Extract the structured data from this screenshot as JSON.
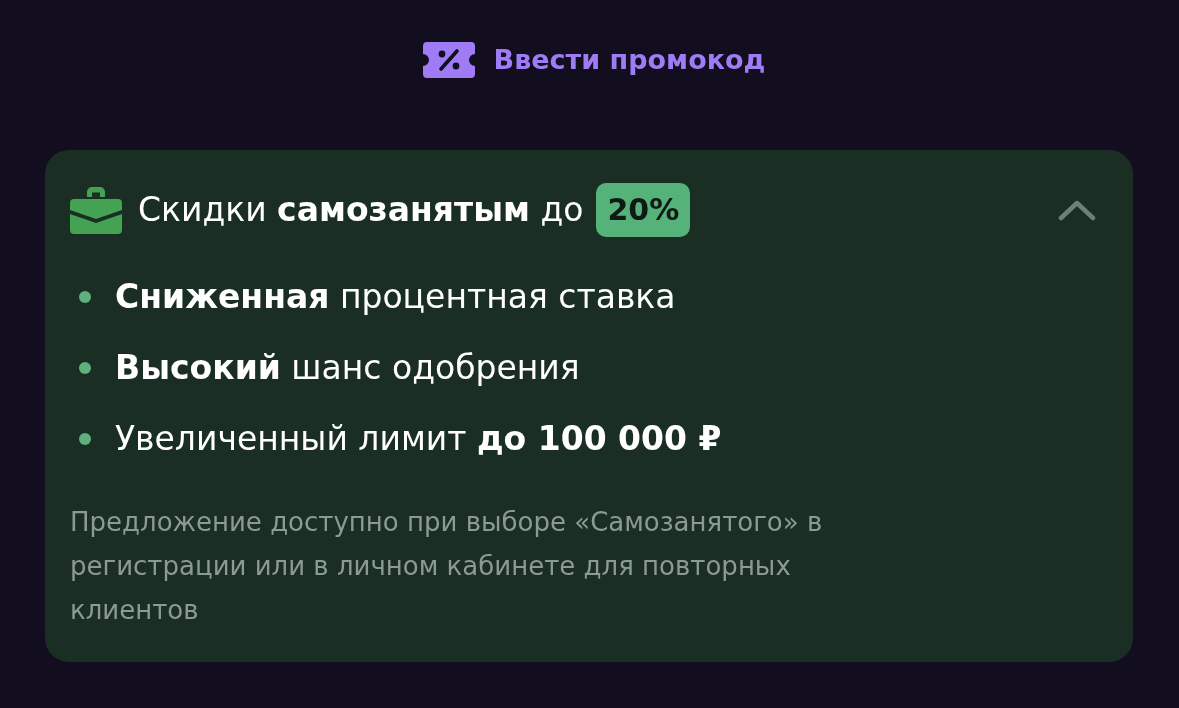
{
  "promo_link": {
    "label": "Ввести промокод"
  },
  "offer_card": {
    "title": "Скидки **самозанятым** до",
    "badge": "20%",
    "expanded": true,
    "benefits": [
      "**Сниженная** процентная ставка",
      "**Высокий** шанс одобрения",
      "Увеличенный лимит **до 100 000 ₽**"
    ],
    "note": "Предложение доступно при выборе «Самозанятого» в регистрации или в личном кабинете для повторных клиентов"
  }
}
